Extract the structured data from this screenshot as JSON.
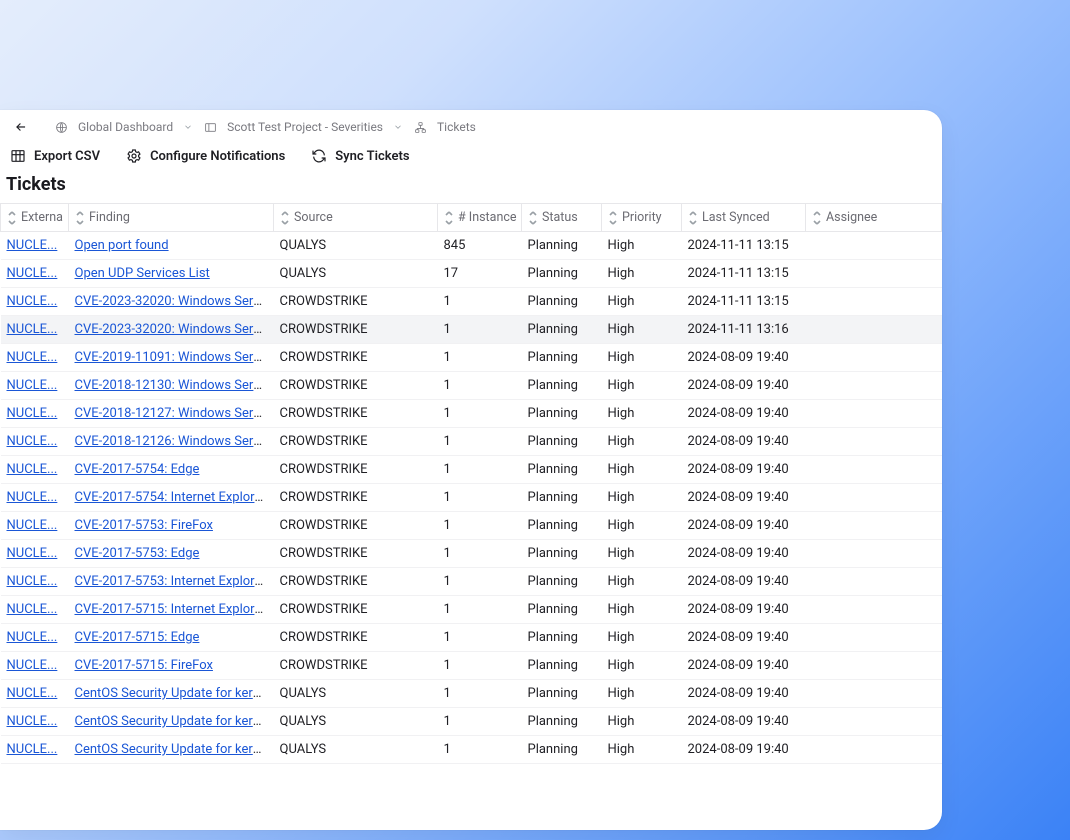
{
  "breadcrumb": {
    "back_icon": "arrow-left",
    "items": [
      {
        "icon": "globe",
        "label": "Global Dashboard",
        "chevron": true
      },
      {
        "icon": "panel",
        "label": "Scott Test Project - Severities",
        "chevron": true
      },
      {
        "icon": "tree",
        "label": "Tickets",
        "chevron": false
      }
    ]
  },
  "toolbar": {
    "export_csv": "Export CSV",
    "configure_notifications": "Configure Notifications",
    "sync_tickets": "Sync Tickets"
  },
  "page_title": "Tickets",
  "columns": {
    "external": "Externa",
    "finding": "Finding",
    "source": "Source",
    "instances": "# Instance",
    "status": "Status",
    "priority": "Priority",
    "last_synced": "Last Synced",
    "assignee": "Assignee"
  },
  "hovered_row_index": 3,
  "rows": [
    {
      "ext": "NUCLE...",
      "finding": "Open port found",
      "src": "QUALYS",
      "inst": "845",
      "status": "Planning",
      "prio": "High",
      "sync": "2024-11-11 13:15",
      "assg": ""
    },
    {
      "ext": "NUCLE...",
      "finding": "Open UDP Services List",
      "src": "QUALYS",
      "inst": "17",
      "status": "Planning",
      "prio": "High",
      "sync": "2024-11-11 13:15",
      "assg": ""
    },
    {
      "ext": "NUCLE...",
      "finding": "CVE-2023-32020: Windows Serv...",
      "src": "CROWDSTRIKE",
      "inst": "1",
      "status": "Planning",
      "prio": "High",
      "sync": "2024-11-11 13:15",
      "assg": ""
    },
    {
      "ext": "NUCLE...",
      "finding": "CVE-2023-32020: Windows Serv...",
      "src": "CROWDSTRIKE",
      "inst": "1",
      "status": "Planning",
      "prio": "High",
      "sync": "2024-11-11 13:16",
      "assg": ""
    },
    {
      "ext": "NUCLE...",
      "finding": "CVE-2019-11091: Windows Serve...",
      "src": "CROWDSTRIKE",
      "inst": "1",
      "status": "Planning",
      "prio": "High",
      "sync": "2024-08-09 19:40",
      "assg": ""
    },
    {
      "ext": "NUCLE...",
      "finding": "CVE-2018-12130: Windows Serve...",
      "src": "CROWDSTRIKE",
      "inst": "1",
      "status": "Planning",
      "prio": "High",
      "sync": "2024-08-09 19:40",
      "assg": ""
    },
    {
      "ext": "NUCLE...",
      "finding": "CVE-2018-12127: Windows Serve...",
      "src": "CROWDSTRIKE",
      "inst": "1",
      "status": "Planning",
      "prio": "High",
      "sync": "2024-08-09 19:40",
      "assg": ""
    },
    {
      "ext": "NUCLE...",
      "finding": "CVE-2018-12126: Windows Serve...",
      "src": "CROWDSTRIKE",
      "inst": "1",
      "status": "Planning",
      "prio": "High",
      "sync": "2024-08-09 19:40",
      "assg": ""
    },
    {
      "ext": "NUCLE...",
      "finding": "CVE-2017-5754: Edge",
      "src": "CROWDSTRIKE",
      "inst": "1",
      "status": "Planning",
      "prio": "High",
      "sync": "2024-08-09 19:40",
      "assg": ""
    },
    {
      "ext": "NUCLE...",
      "finding": "CVE-2017-5754: Internet Explorer...",
      "src": "CROWDSTRIKE",
      "inst": "1",
      "status": "Planning",
      "prio": "High",
      "sync": "2024-08-09 19:40",
      "assg": ""
    },
    {
      "ext": "NUCLE...",
      "finding": "CVE-2017-5753: FireFox",
      "src": "CROWDSTRIKE",
      "inst": "1",
      "status": "Planning",
      "prio": "High",
      "sync": "2024-08-09 19:40",
      "assg": ""
    },
    {
      "ext": "NUCLE...",
      "finding": "CVE-2017-5753: Edge",
      "src": "CROWDSTRIKE",
      "inst": "1",
      "status": "Planning",
      "prio": "High",
      "sync": "2024-08-09 19:40",
      "assg": ""
    },
    {
      "ext": "NUCLE...",
      "finding": "CVE-2017-5753: Internet Explorer...",
      "src": "CROWDSTRIKE",
      "inst": "1",
      "status": "Planning",
      "prio": "High",
      "sync": "2024-08-09 19:40",
      "assg": ""
    },
    {
      "ext": "NUCLE...",
      "finding": "CVE-2017-5715: Internet Explorer...",
      "src": "CROWDSTRIKE",
      "inst": "1",
      "status": "Planning",
      "prio": "High",
      "sync": "2024-08-09 19:40",
      "assg": ""
    },
    {
      "ext": "NUCLE...",
      "finding": "CVE-2017-5715: Edge",
      "src": "CROWDSTRIKE",
      "inst": "1",
      "status": "Planning",
      "prio": "High",
      "sync": "2024-08-09 19:40",
      "assg": ""
    },
    {
      "ext": "NUCLE...",
      "finding": "CVE-2017-5715: FireFox",
      "src": "CROWDSTRIKE",
      "inst": "1",
      "status": "Planning",
      "prio": "High",
      "sync": "2024-08-09 19:40",
      "assg": ""
    },
    {
      "ext": "NUCLE...",
      "finding": "CentOS Security Update for kern...",
      "src": "QUALYS",
      "inst": "1",
      "status": "Planning",
      "prio": "High",
      "sync": "2024-08-09 19:40",
      "assg": ""
    },
    {
      "ext": "NUCLE...",
      "finding": "CentOS Security Update for kern...",
      "src": "QUALYS",
      "inst": "1",
      "status": "Planning",
      "prio": "High",
      "sync": "2024-08-09 19:40",
      "assg": ""
    },
    {
      "ext": "NUCLE...",
      "finding": "CentOS Security Update for kern...",
      "src": "QUALYS",
      "inst": "1",
      "status": "Planning",
      "prio": "High",
      "sync": "2024-08-09 19:40",
      "assg": ""
    }
  ]
}
